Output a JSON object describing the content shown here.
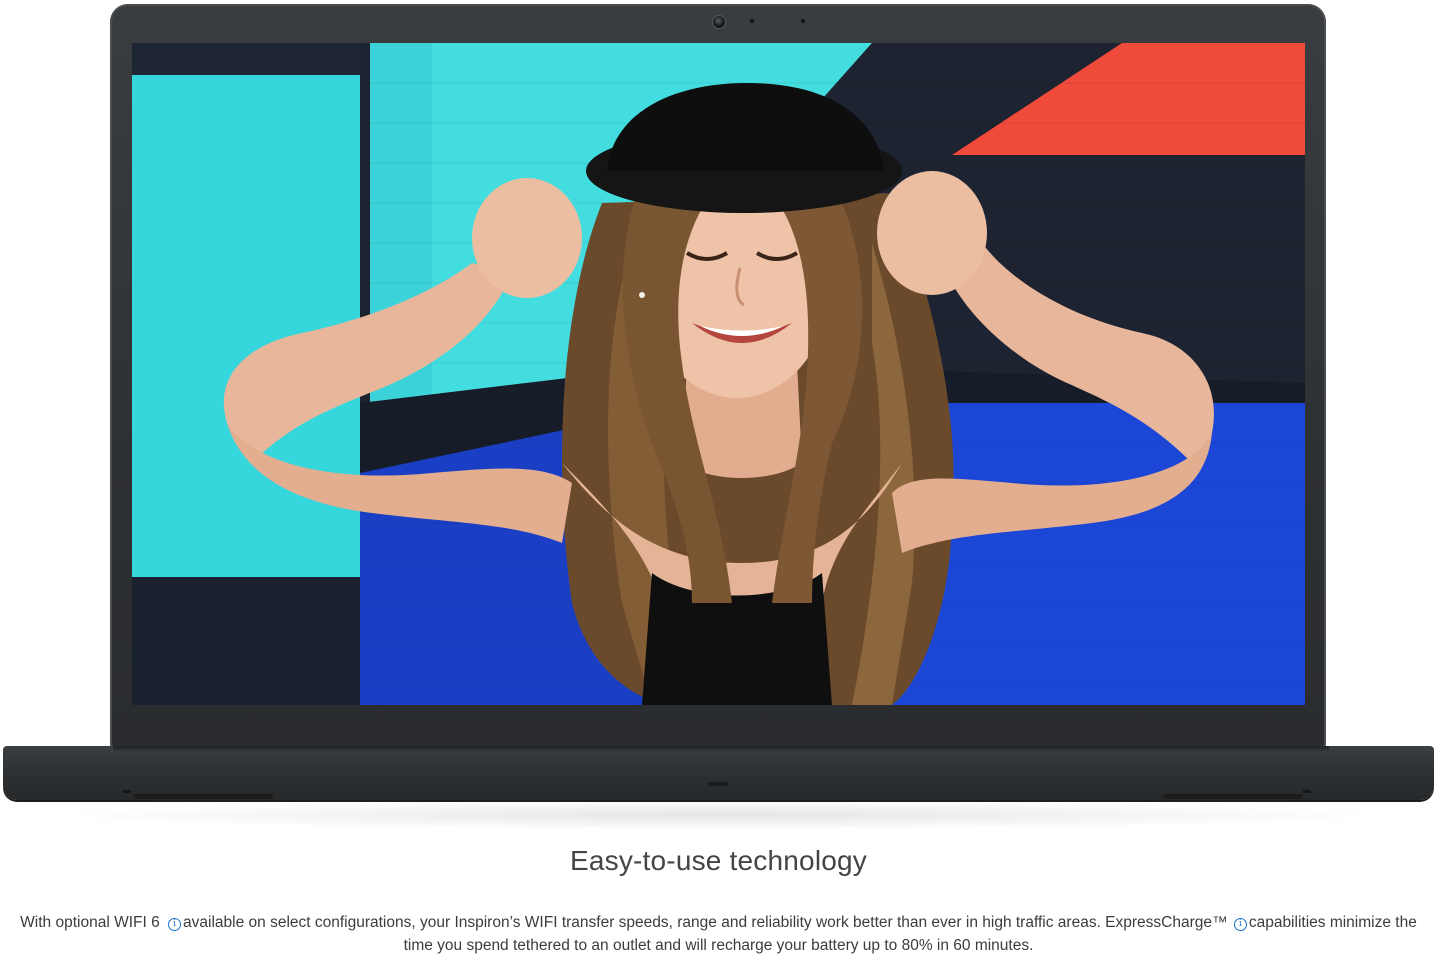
{
  "hero": {
    "image_subject": "laptop-screen-photo",
    "colors": {
      "lid": "#2e3134",
      "screen_teal": "#35d6dc",
      "screen_navy": "#1b2230",
      "screen_red": "#f04a3a",
      "screen_blue": "#1c46d6",
      "hat": "#121212"
    }
  },
  "section": {
    "title": "Easy-to-use technology",
    "desc_part1": "With optional WIFI 6 ",
    "info_icon_1": "i",
    "desc_part2": "available on select configurations, your Inspiron’s WIFI transfer speeds, range and reliability work better than ever in high traffic areas. ExpressCharge™ ",
    "info_icon_2": "i",
    "desc_part3": "capabilities minimize the time you spend tethered to an outlet and will recharge your battery up to 80% in 60 minutes."
  }
}
